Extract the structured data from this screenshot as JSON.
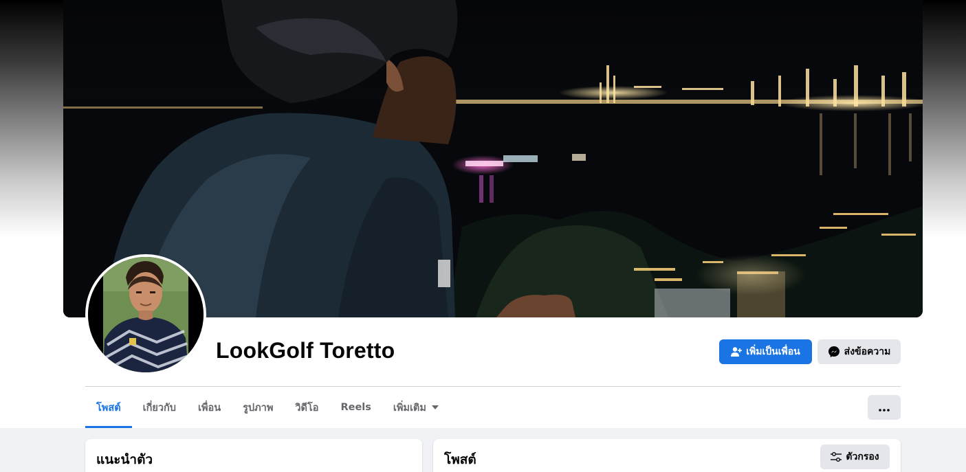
{
  "profile": {
    "name": "LookGolf Toretto"
  },
  "actions": {
    "add_friend_label": "เพิ่มเป็นเพื่อน",
    "message_label": "ส่งข้อความ"
  },
  "tabs": [
    {
      "label": "โพสต์",
      "active": true
    },
    {
      "label": "เกี่ยวกับ",
      "active": false
    },
    {
      "label": "เพื่อน",
      "active": false
    },
    {
      "label": "รูปภาพ",
      "active": false
    },
    {
      "label": "วิดีโอ",
      "active": false
    },
    {
      "label": "Reels",
      "active": false
    },
    {
      "label": "เพิ่มเติม",
      "active": false
    }
  ],
  "intro_card": {
    "title": "แนะนำตัว"
  },
  "posts_card": {
    "title": "โพสต์",
    "filter_label": "ตัวกรอง"
  },
  "colors": {
    "accent": "#1b74e4",
    "button_gray": "#e4e6eb",
    "page_bg": "#f0f2f5"
  },
  "icons": {
    "add_friend": "person-add-icon",
    "message": "messenger-icon",
    "caret": "caret-down-icon",
    "more": "ellipsis-icon",
    "filter": "sliders-icon"
  }
}
